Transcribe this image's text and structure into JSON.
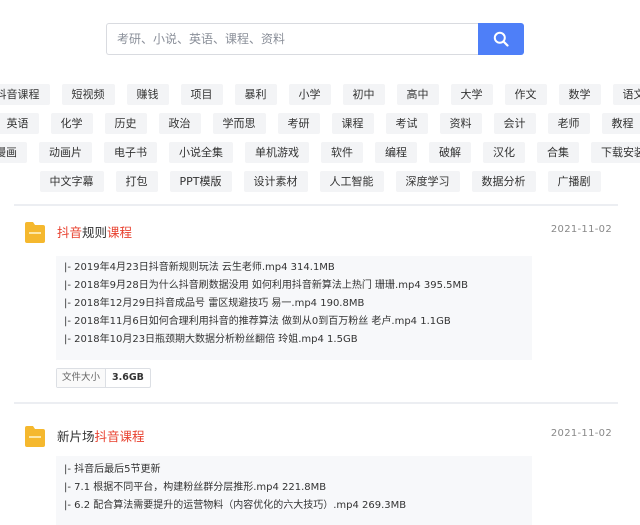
{
  "search": {
    "placeholder": "考研、小说、英语、课程、资料"
  },
  "tags": [
    [
      "抖音课程",
      "短视频",
      "赚钱",
      "项目",
      "暴利",
      "小学",
      "初中",
      "高中",
      "大学",
      "作文",
      "数学",
      "语文"
    ],
    [
      "英语",
      "化学",
      "历史",
      "政治",
      "学而思",
      "考研",
      "课程",
      "考试",
      "资料",
      "会计",
      "老师",
      "教程"
    ],
    [
      "漫画",
      "动画片",
      "电子书",
      "小说全集",
      "单机游戏",
      "软件",
      "编程",
      "破解",
      "汉化",
      "合集",
      "下载安装"
    ],
    [
      "中文字幕",
      "打包",
      "PPT模版",
      "设计素材",
      "人工智能",
      "深度学习",
      "数据分析",
      "广播剧"
    ]
  ],
  "results": [
    {
      "title_hl1": "抖音",
      "title_mid": "规则",
      "title_hl2": "课程",
      "date": "2021-11-02",
      "files": [
        "|- 2019年4月23日抖音新规则玩法 云生老师.mp4  314.1MB",
        "|- 2018年9月28日为什么抖音刷数据没用 如何利用抖音新算法上热门 珊珊.mp4  395.5MB",
        "|- 2018年12月29日抖音成品号 雷区规避技巧 易一.mp4  190.8MB",
        "|- 2018年11月6日如何合理利用抖音的推荐算法 做到从0到百万粉丝 老卢.mp4  1.1GB",
        "|- 2018年10月23日瓶颈期大数据分析粉丝翻倍 玲姐.mp4  1.5GB"
      ],
      "size_label": "文件大小",
      "size_value": "3.6GB"
    },
    {
      "title_pre": "新片场",
      "title_hl": "抖音课程",
      "date": "2021-11-02",
      "files": [
        "|- 抖音后最后5节更新",
        "|- 7.1 根据不同平台，构建粉丝群分层推形.mp4  221.8MB",
        "|- 6.2 配合算法需要提升的运营物料（内容优化的六大技巧）.mp4  269.3MB"
      ]
    }
  ],
  "colors": {
    "accent": "#4e7ff8",
    "highlight": "#e8412f",
    "folder": "#f5b82e"
  },
  "icons": {
    "search": "search-icon",
    "folder": "folder-icon"
  }
}
